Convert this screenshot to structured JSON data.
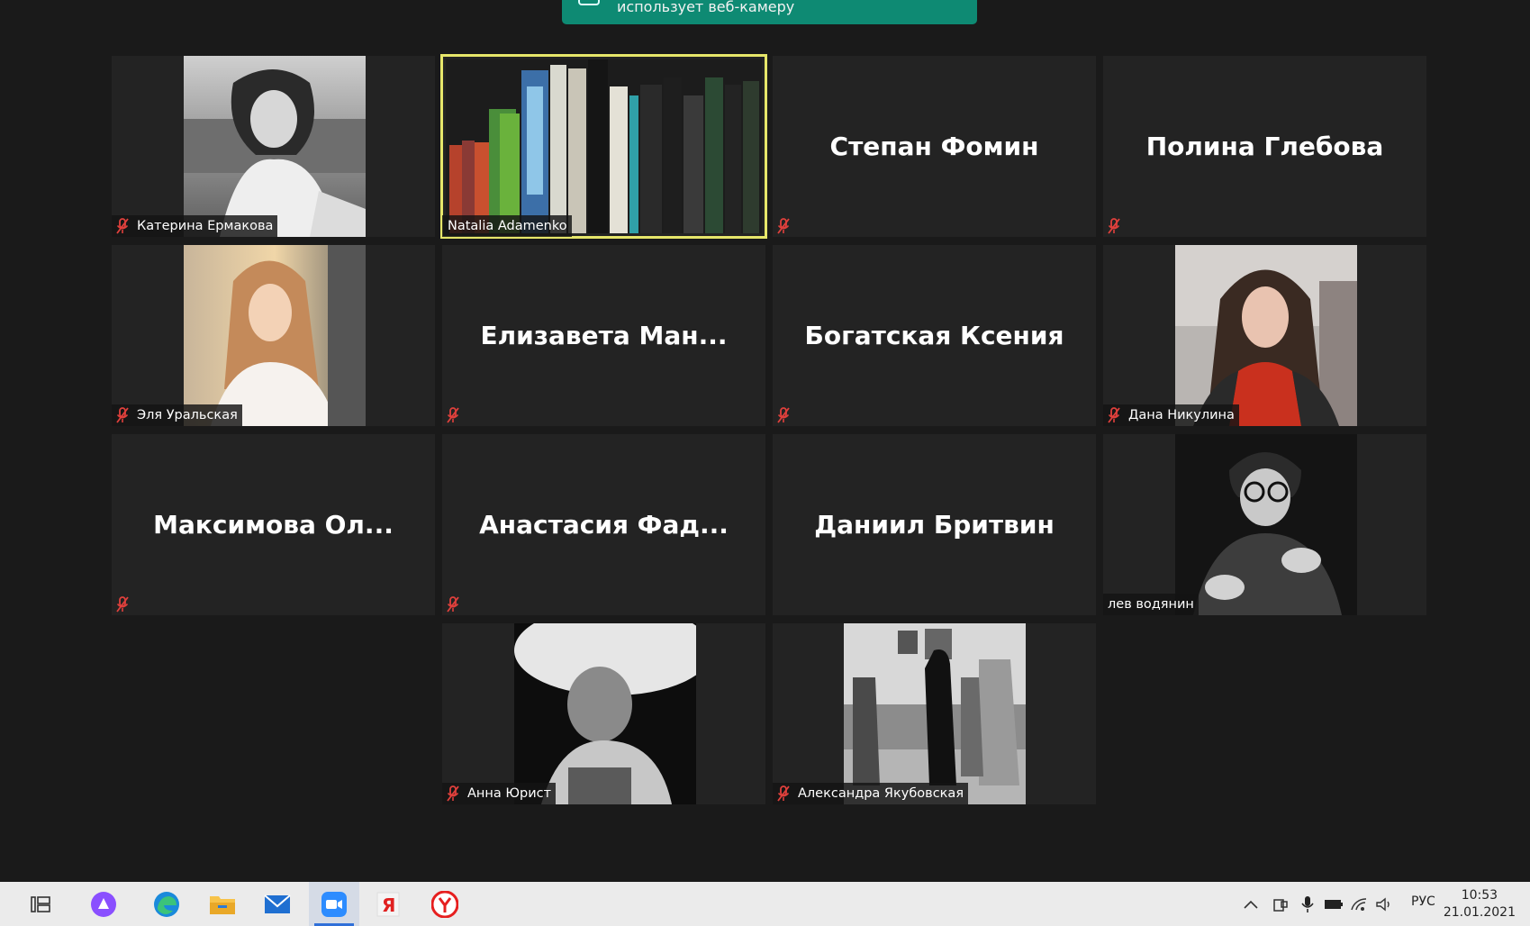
{
  "notification": {
    "text": "использует веб-камеру"
  },
  "participants": [
    {
      "id": "p1",
      "name": "Катерина Ермакова",
      "video": "photo",
      "muted": true
    },
    {
      "id": "p2",
      "name": "Natalia Adamenko",
      "video": "books",
      "muted": false,
      "active": true
    },
    {
      "id": "p3",
      "name": "Степан Фомин",
      "video": "off",
      "muted": true
    },
    {
      "id": "p4",
      "name": "Полина Глебова",
      "video": "off",
      "muted": true
    },
    {
      "id": "p5",
      "name": "Эля Уральская",
      "video": "photo",
      "muted": true
    },
    {
      "id": "p6",
      "name": "Елизавета  Ман...",
      "video": "off",
      "muted": true
    },
    {
      "id": "p7",
      "name": "Богатская Ксения",
      "video": "off",
      "muted": true
    },
    {
      "id": "p8",
      "name": "Дана Никулина",
      "video": "photo",
      "muted": true
    },
    {
      "id": "p9",
      "name": "Максимова  Ол...",
      "video": "off",
      "muted": true
    },
    {
      "id": "p10",
      "name": "Анастасия  Фад...",
      "video": "off",
      "muted": true
    },
    {
      "id": "p11",
      "name": "Даниил Бритвин",
      "video": "off",
      "muted": false
    },
    {
      "id": "p12",
      "name": "лев водянин",
      "video": "photo",
      "muted": false
    },
    {
      "id": "p13",
      "name": "Анна Юрист",
      "video": "photo",
      "muted": true
    },
    {
      "id": "p14",
      "name": "Александра Якубовская",
      "video": "photo",
      "muted": true
    }
  ],
  "taskbar": {
    "language": "РУС",
    "time": "10:53",
    "date": "21.01.2021",
    "apps": [
      "task-view-icon",
      "alice-icon",
      "edge-icon",
      "file-explorer-icon",
      "mail-icon",
      "zoom-icon",
      "yandex-icon",
      "yandex-browser-icon"
    ],
    "active_app": "zoom-icon"
  },
  "colors": {
    "background": "#1a1a1a",
    "tile": "#232323",
    "active_outline": "#e6e66a",
    "mute_icon": "#e0403c",
    "notice": "#0e8a73"
  }
}
